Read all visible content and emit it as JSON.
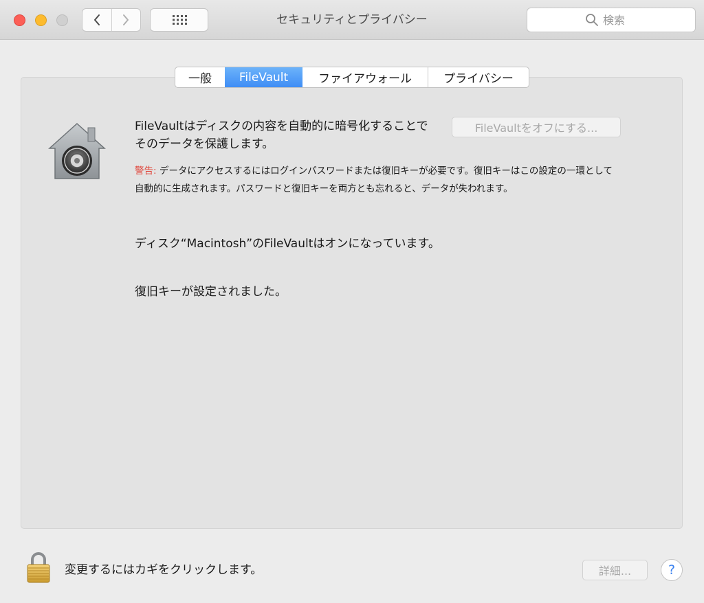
{
  "window": {
    "title": "セキュリティとプライバシー"
  },
  "toolbar": {
    "back_icon": "chevron-left-icon",
    "forward_icon": "chevron-right-icon",
    "show_all_icon": "grid-icon"
  },
  "search": {
    "placeholder": "検索",
    "value": ""
  },
  "tabs": [
    {
      "label": "一般",
      "active": false
    },
    {
      "label": "FileVault",
      "active": true
    },
    {
      "label": "ファイアウォール",
      "active": false
    },
    {
      "label": "プライバシー",
      "active": false
    }
  ],
  "filevault": {
    "icon": "filevault-house-icon",
    "description": "FileVaultはディスクの内容を自動的に暗号化することでそのデータを保護します。",
    "turn_off_button": "FileVaultをオフにする...",
    "warning_label": "警告:",
    "warning_text": " データにアクセスするにはログインパスワードまたは復旧キーが必要です。復旧キーはこの設定の一環として自動的に生成されます。パスワードと復旧キーを両方とも忘れると、データが失われます。",
    "status": "ディスク“Macintosh”のFileVaultはオンになっています。",
    "recovery_key_status": "復旧キーが設定されました。"
  },
  "footer": {
    "lock_icon": "padlock-icon",
    "lock_text": "変更するにはカギをクリックします。",
    "advanced_button": "詳細...",
    "help_button": "?"
  },
  "colors": {
    "accent": "#3f8df5",
    "warning": "#e0483e",
    "close": "#fc5f57",
    "minimize": "#fdbb2e",
    "zoom_disabled": "#d0d0d0"
  }
}
